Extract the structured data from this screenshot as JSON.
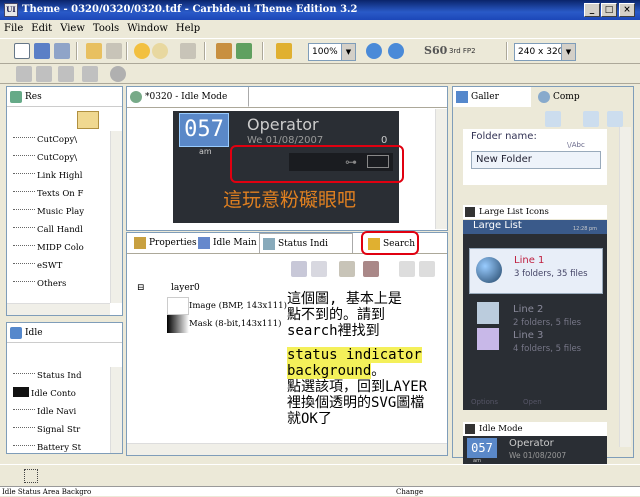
{
  "window": {
    "title": "Theme - 0320/0320/0320.tdf - Carbide.ui Theme Edition 3.2",
    "app_icon": "UI",
    "min": "_",
    "max": "□",
    "close": "×"
  },
  "menu": [
    "File",
    "Edit",
    "View",
    "Tools",
    "Window",
    "Help"
  ],
  "toolbar": {
    "zoom": "100%",
    "s60": "S60",
    "s60_sub": "3rd FP2",
    "resolution": "240 x 320"
  },
  "res_panel": {
    "tab": "Res",
    "items": [
      "CutCopy\\",
      "CutCopy\\",
      "Link Highl",
      "Texts On F",
      "Music Play",
      "Call Handl",
      "MIDP Colo",
      "eSWT",
      "Others"
    ]
  },
  "idle_panel": {
    "tab": "Idle",
    "items": [
      "Status Ind",
      "Idle Conto",
      "Idle Navi",
      "Signal Str",
      "Battery St"
    ]
  },
  "editor": {
    "tab": "*0320 - Idle Mode",
    "clock": "057",
    "am": "am",
    "operator": "Operator",
    "date": "We 01/08/2007",
    "digit": "0",
    "chinese_text": "這玩意粉礙眼吧"
  },
  "props_tabs": {
    "properties": "Properties",
    "idle_main": "Idle Main",
    "status_ind": "Status Indi",
    "search": "Search"
  },
  "layer_tree": {
    "root": "layer0",
    "image": "Image (BMP, 143x111)",
    "mask": "Mask (8-bit,143x111)"
  },
  "note": {
    "lines": [
      "這個圖, 基本上是",
      "點不到的。請到",
      "search裡找到"
    ],
    "hl1": "status indicator",
    "hl2": "background",
    "hl2_tail": "。",
    "lines2": [
      "點選該項，回到LAYER",
      "裡換個透明的SVG圖檔",
      "就OK了"
    ]
  },
  "gallery": {
    "tab": "Galler",
    "comp_tab": "Comp",
    "folder_label": "Folder name:",
    "abc": "\\/Abc",
    "folder_value": "New Folder",
    "large_list_head": "Large List Icons",
    "large_list_title": "Large List",
    "list_time": "12:28 pm",
    "items": [
      {
        "title": "Line 1",
        "sub": "3 folders, 35 files"
      },
      {
        "title": "Line 2",
        "sub": "2 folders, 5 files"
      },
      {
        "title": "Line 3",
        "sub": "4 folders, 5 files"
      }
    ],
    "soft_left": "Options",
    "soft_right": "Open",
    "idle_mode_head": "Idle Mode",
    "idle_clock": "057",
    "idle_operator": "Operator",
    "idle_am": "am",
    "idle_date": "We 01/08/2007"
  },
  "status": {
    "left": "Idle Status Area Backgro",
    "right": "Change"
  }
}
